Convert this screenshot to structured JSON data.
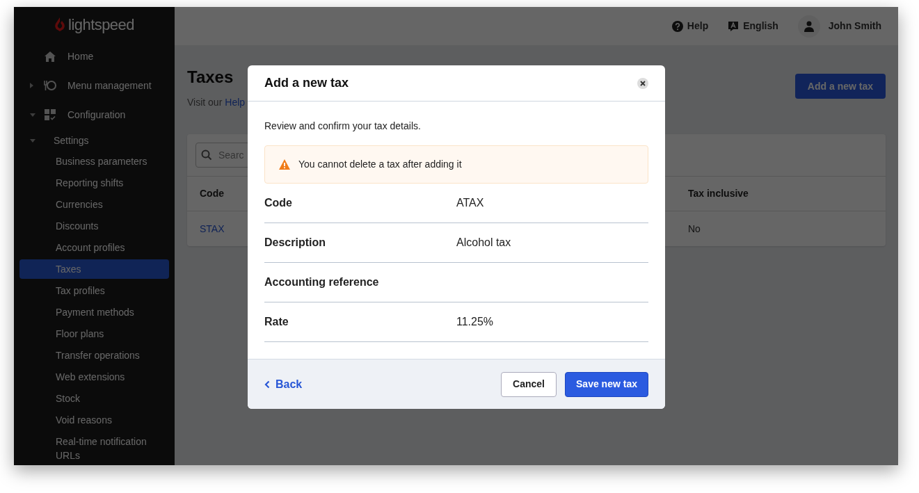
{
  "sidebar": {
    "logo": "lightspeed",
    "items": [
      {
        "label": "Home"
      },
      {
        "label": "Menu management",
        "expanded": false
      },
      {
        "label": "Configuration",
        "expanded": true,
        "children": [
          {
            "label": "Settings",
            "expanded": true,
            "children": [
              {
                "label": "Business parameters",
                "selected": false
              },
              {
                "label": "Reporting shifts",
                "selected": false
              },
              {
                "label": "Currencies",
                "selected": false
              },
              {
                "label": "Discounts",
                "selected": false
              },
              {
                "label": "Account profiles",
                "selected": false
              },
              {
                "label": "Taxes",
                "selected": true
              },
              {
                "label": "Tax profiles",
                "selected": false
              },
              {
                "label": "Payment methods",
                "selected": false
              },
              {
                "label": "Floor plans",
                "selected": false
              },
              {
                "label": "Transfer operations",
                "selected": false
              },
              {
                "label": "Web extensions",
                "selected": false
              },
              {
                "label": "Stock",
                "selected": false
              },
              {
                "label": "Void reasons",
                "selected": false
              },
              {
                "label": "Real-time notification URLs",
                "selected": false
              }
            ]
          }
        ]
      }
    ]
  },
  "header": {
    "help": "Help",
    "language": "English",
    "user": "John Smith"
  },
  "page": {
    "title": "Taxes",
    "help_text": "Visit our",
    "help_link": "Help",
    "add_button": "Add a new tax",
    "search": {
      "placeholder": "Searc"
    },
    "table": {
      "columns": [
        "Code",
        "Tax inclusive"
      ],
      "rows": [
        [
          "STAX",
          "No"
        ]
      ]
    }
  },
  "modal": {
    "title": "Add a new tax",
    "intro": "Review and confirm your tax details.",
    "warning": "You cannot delete a tax after adding it",
    "fields": [
      {
        "label": "Code",
        "value": "ATAX"
      },
      {
        "label": "Description",
        "value": "Alcohol tax"
      },
      {
        "label": "Accounting reference"
      },
      {
        "label": "Rate",
        "value": "11.25%"
      }
    ],
    "back": "Back",
    "cancel": "Cancel",
    "save": "Save new tax"
  }
}
